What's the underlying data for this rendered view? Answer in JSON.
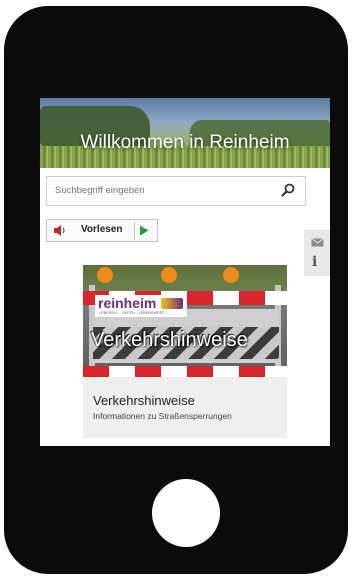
{
  "hero": {
    "title": "Willkommen in Reinheim"
  },
  "search": {
    "placeholder": "Suchbegriff eingeben"
  },
  "reader": {
    "label": "Vorlesen"
  },
  "side_tools": {
    "info_glyph": "i"
  },
  "card": {
    "logo_text": "reinheim",
    "logo_tagline": "LEBENDIG · OFFEN · LEBENSWERT",
    "overlay_title": "Verkehrshinweise",
    "title": "Verkehrshinweise",
    "subtitle": "Informationen zu Straßensperrungen"
  },
  "colors": {
    "phone_body": "#0b0b0b",
    "play_green": "#2a9a3c",
    "speaker_red": "#c8262a",
    "logo_purple": "#6e2d7a",
    "barrier_red": "#d8262a"
  },
  "icons": [
    "search-icon",
    "speaker-icon",
    "play-icon",
    "mail-icon",
    "info-icon"
  ]
}
